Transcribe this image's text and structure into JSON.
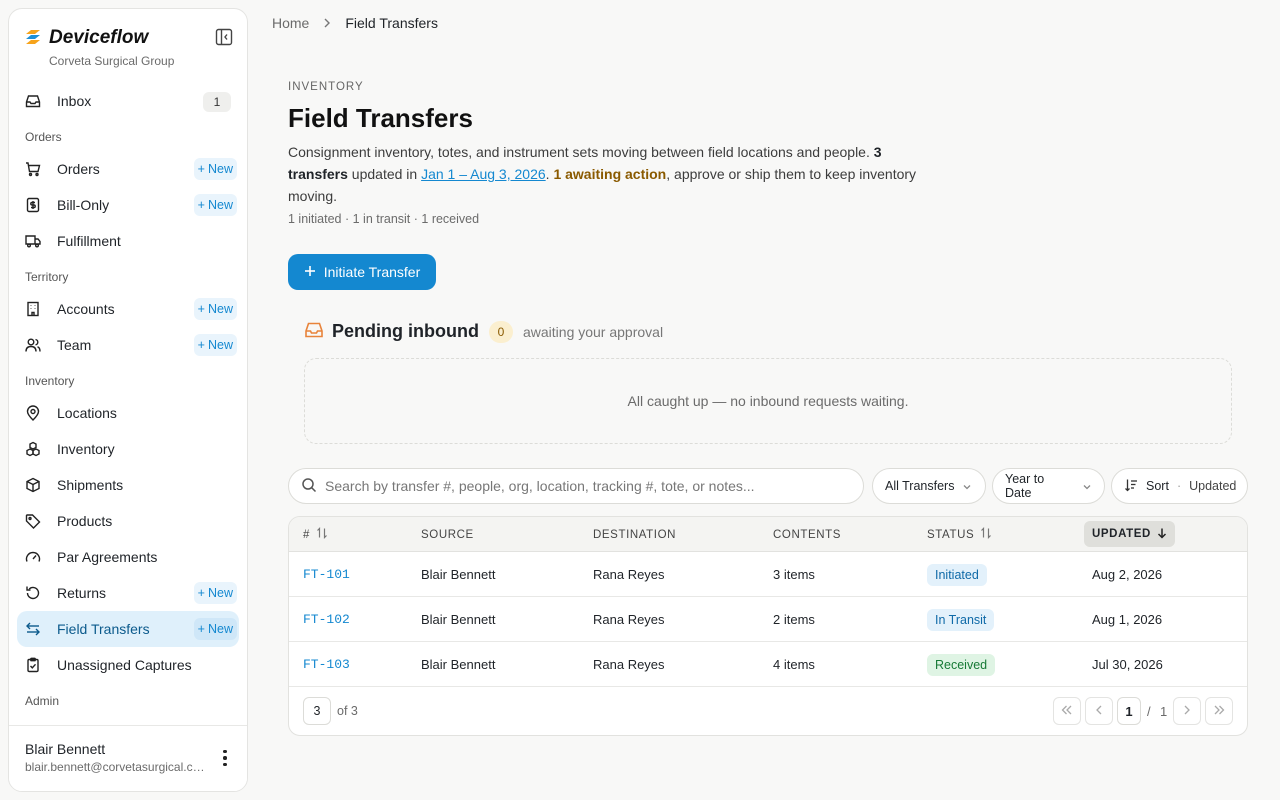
{
  "app": {
    "name": "Deviceflow",
    "org": "Corveta Surgical Group"
  },
  "sidebar": {
    "new_label": "New",
    "inbox": {
      "label": "Inbox",
      "count": "1"
    },
    "sections": {
      "orders": "Orders",
      "territory": "Territory",
      "inventory": "Inventory",
      "admin": "Admin"
    },
    "items": {
      "orders": "Orders",
      "bill_only": "Bill-Only",
      "fulfillment": "Fulfillment",
      "accounts": "Accounts",
      "team": "Team",
      "locations": "Locations",
      "inventory": "Inventory",
      "shipments": "Shipments",
      "products": "Products",
      "par_agreements": "Par Agreements",
      "returns": "Returns",
      "field_transfers": "Field Transfers",
      "unassigned_captures": "Unassigned Captures"
    },
    "user": {
      "name": "Blair Bennett",
      "email": "blair.bennett@corvetasurgical.com"
    }
  },
  "breadcrumb": {
    "home": "Home",
    "current": "Field Transfers"
  },
  "header": {
    "eyebrow": "INVENTORY",
    "title": "Field Transfers",
    "desc_1": "Consignment inventory, totes, and instrument sets moving between field locations and people. ",
    "desc_count": "3 transfers",
    "desc_2": " updated in ",
    "desc_range": "Jan 1 – Aug 3, 2026",
    "desc_3": ". ",
    "desc_awaiting": "1 awaiting action",
    "desc_4": ", approve or ship them to keep inventory moving.",
    "stats": "1 initiated · 1 in transit · 1 received"
  },
  "actions": {
    "initiate": "Initiate Transfer"
  },
  "pending": {
    "title": "Pending inbound",
    "count": "0",
    "subtitle": "awaiting your approval",
    "empty": "All caught up — no inbound requests waiting."
  },
  "filters": {
    "search_placeholder": "Search by transfer #, people, org, location, tracking #, tote, or notes...",
    "transfers": "All Transfers",
    "period": "Year to Date",
    "sort_label": "Sort",
    "sort_sep": "·",
    "sort_value": "Updated"
  },
  "table": {
    "headers": {
      "id": "#",
      "source": "SOURCE",
      "destination": "DESTINATION",
      "contents": "CONTENTS",
      "status": "STATUS",
      "updated": "UPDATED"
    },
    "rows": [
      {
        "id": "FT-101",
        "source": "Blair Bennett",
        "destination": "Rana Reyes",
        "contents": "3 items",
        "status": "Initiated",
        "updated": "Aug 2, 2026"
      },
      {
        "id": "FT-102",
        "source": "Blair Bennett",
        "destination": "Rana Reyes",
        "contents": "2 items",
        "status": "In Transit",
        "updated": "Aug 1, 2026"
      },
      {
        "id": "FT-103",
        "source": "Blair Bennett",
        "destination": "Rana Reyes",
        "contents": "4 items",
        "status": "Received",
        "updated": "Jul 30, 2026"
      }
    ],
    "page_size": "3",
    "total": "of 3",
    "page": "1",
    "page_sep": "/",
    "page_total": "1"
  },
  "colors": {
    "accent": "#1488d0",
    "active_bg": "#dff0fb",
    "pending_icon": "#e8833a",
    "received": "#177a36"
  }
}
